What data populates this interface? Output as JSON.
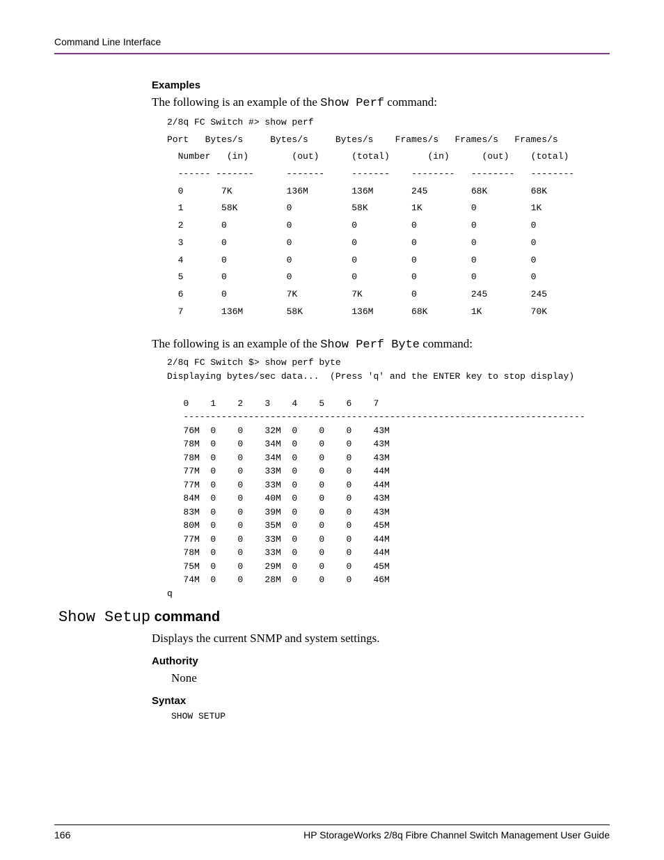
{
  "header": {
    "running": "Command Line Interface"
  },
  "examples": {
    "heading": "Examples",
    "intro1_pre": "The following is an example of the ",
    "intro1_cmd": "Show Perf",
    "intro1_post": " command:",
    "code1": "2/8q FC Switch #> show perf\nPort   Bytes/s     Bytes/s     Bytes/s    Frames/s   Frames/s   Frames/s\n  Number   (in)        (out)      (total)       (in)      (out)    (total)\n  ------ -------      -------     -------    --------   --------   --------\n  0       7K          136M        136M       245        68K        68K\n  1       58K         0           58K        1K         0          1K\n  2       0           0           0          0          0          0\n  3       0           0           0          0          0          0\n  4       0           0           0          0          0          0\n  5       0           0           0          0          0          0\n  6       0           7K          7K         0          245        245\n  7       136M        58K         136M       68K        1K         70K",
    "intro2_pre": "The following is an example of the ",
    "intro2_cmd": "Show Perf Byte",
    "intro2_post": " command:",
    "code2": "2/8q FC Switch $> show perf byte\nDisplaying bytes/sec data...  (Press 'q' and the ENTER key to stop display)\n\n   0    1    2    3    4    5    6    7\n   --------------------------------------------------------------------------\n   76M  0    0    32M  0    0    0    43M\n   78M  0    0    34M  0    0    0    43M\n   78M  0    0    34M  0    0    0    43M\n   77M  0    0    33M  0    0    0    44M\n   77M  0    0    33M  0    0    0    44M\n   84M  0    0    40M  0    0    0    43M\n   83M  0    0    39M  0    0    0    43M\n   80M  0    0    35M  0    0    0    45M\n   77M  0    0    33M  0    0    0    44M\n   78M  0    0    33M  0    0    0    44M\n   75M  0    0    29M  0    0    0    45M\n   74M  0    0    28M  0    0    0    46M\nq"
  },
  "showsetup": {
    "heading_mono": "Show Setup",
    "heading_bold": " command",
    "desc": "Displays the current SNMP and system settings.",
    "authority_h": "Authority",
    "authority_v": "None",
    "syntax_h": "Syntax",
    "syntax_v": "SHOW SETUP"
  },
  "footer": {
    "page": "166",
    "title": "HP StorageWorks 2/8q Fibre Channel Switch Management User Guide"
  }
}
